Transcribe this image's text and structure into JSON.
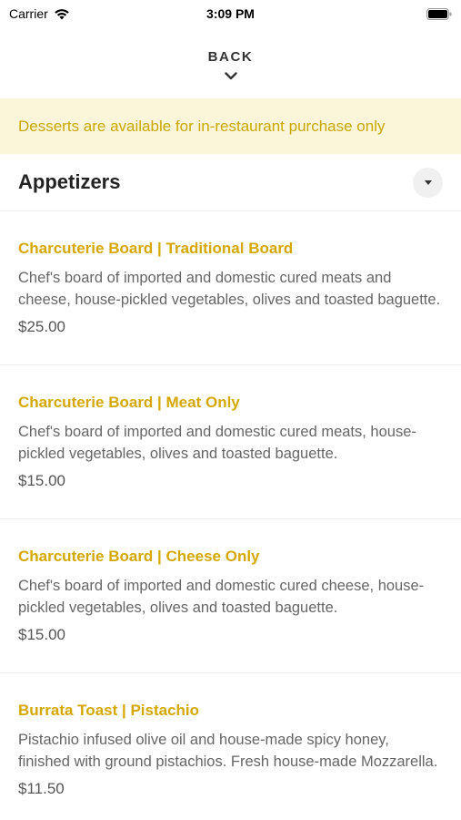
{
  "status_bar": {
    "carrier": "Carrier",
    "time": "3:09 PM"
  },
  "nav": {
    "back_label": "BACK"
  },
  "notice": {
    "text": "Desserts are available for in-restaurant purchase only"
  },
  "section": {
    "title": "Appetizers"
  },
  "items": [
    {
      "name": "Charcuterie Board | Traditional Board",
      "description": "Chef's board of imported and domestic cured meats and cheese, house-pickled vegetables, olives and toasted baguette.",
      "price": "$25.00"
    },
    {
      "name": "Charcuterie Board | Meat Only",
      "description": "Chef's board of imported and domestic cured meats, house-pickled vegetables, olives and toasted baguette.",
      "price": "$15.00"
    },
    {
      "name": "Charcuterie Board | Cheese Only",
      "description": "Chef's board of imported and domestic cured cheese, house-pickled vegetables, olives and toasted baguette.",
      "price": "$15.00"
    },
    {
      "name": "Burrata Toast | Pistachio",
      "description": "Pistachio infused olive oil and house-made spicy honey, finished with ground pistachios. Fresh house-made Mozzarella.",
      "price": "$11.50"
    }
  ],
  "colors": {
    "accent": "#d4a800",
    "notice_bg": "#fbf6d9",
    "notice_text": "#c9a700"
  }
}
